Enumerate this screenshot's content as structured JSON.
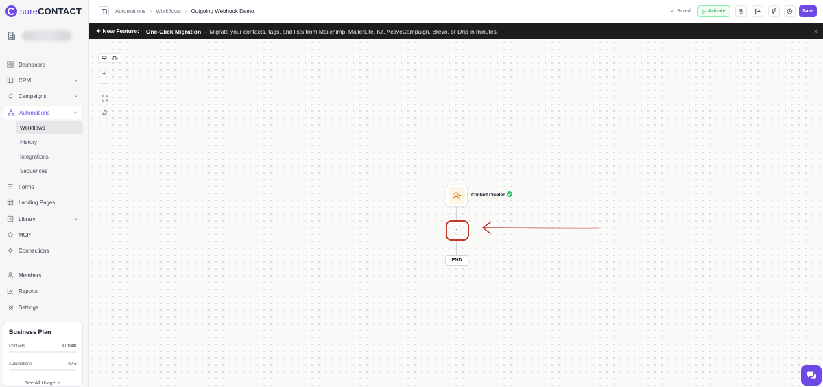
{
  "app": {
    "brand_prefix": "sure",
    "brand_suffix": "CONTACT",
    "accent": "#6d4ae6"
  },
  "sidebar": {
    "items": [
      {
        "label": "Dashboard",
        "icon": "dashboard-icon"
      },
      {
        "label": "CRM",
        "icon": "crm-icon",
        "chevron": "down"
      },
      {
        "label": "Campaigns",
        "icon": "megaphone-icon",
        "chevron": "down"
      },
      {
        "label": "Automations",
        "icon": "automations-icon",
        "chevron": "up",
        "active": true
      },
      {
        "label": "Forms",
        "icon": "forms-icon"
      },
      {
        "label": "Landing Pages",
        "icon": "landing-pages-icon"
      },
      {
        "label": "Library",
        "icon": "library-icon",
        "chevron": "down"
      },
      {
        "label": "MCP",
        "icon": "mcp-icon"
      },
      {
        "label": "Connections",
        "icon": "connections-icon"
      },
      {
        "label": "Members",
        "icon": "members-icon"
      },
      {
        "label": "Reports",
        "icon": "reports-icon"
      },
      {
        "label": "Settings",
        "icon": "settings-icon"
      }
    ],
    "automation_sub": [
      "Workflows",
      "History",
      "Integrations",
      "Sequences"
    ],
    "plan": {
      "title": "Business Plan",
      "contacts_label": "Contacts",
      "contacts_value": "3 / 100K",
      "contacts_fraction": 3e-05,
      "automations_label": "Automations",
      "automations_value": "0 / ∞",
      "automations_fraction": 0,
      "link": "See All Usage ↗"
    }
  },
  "header": {
    "breadcrumb": [
      "Automations",
      "Workflows",
      "Outgoing Webhook Demo"
    ],
    "saved_label": "Saved",
    "activate_label": "Activate",
    "save_label": "Save"
  },
  "banner": {
    "lead": "New Feature:",
    "title": "One-Click Migration",
    "text": "– Migrate your contacts, tags, and lists from Mailchimp, MailerLite, Kit, ActiveCampaign, Brevo, or Drip in minutes.",
    "close": "×"
  },
  "canvas": {
    "trigger_label": "Contact Created",
    "add_symbol": "+",
    "end_label": "END",
    "zoom_in": "+",
    "zoom_out": "–",
    "annotation_color": "#c0392b"
  }
}
